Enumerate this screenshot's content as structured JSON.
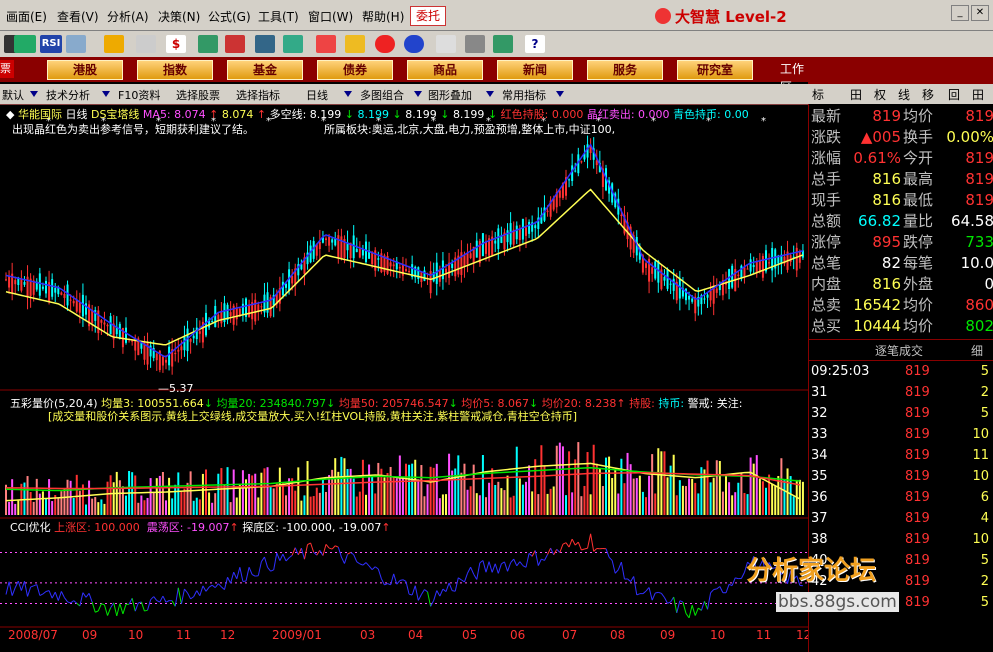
{
  "menu": [
    "画面(E)",
    "查看(V)",
    "分析(A)",
    "决策(N)",
    "公式(G)",
    "工具(T)",
    "窗口(W)",
    "帮助(H)"
  ],
  "entrust_label": "委托",
  "brand": "大智慧 Level-2",
  "nav": {
    "left_label": "票",
    "buttons": [
      "港股",
      "指数",
      "基金",
      "债券",
      "商品",
      "新闻",
      "服务",
      "研究室"
    ],
    "workarea": "工作区"
  },
  "sidetabs": [
    "标",
    "田",
    "权",
    "线",
    "移",
    "回",
    "田"
  ],
  "subtool": [
    "默认",
    "技术分析",
    "F10资料",
    "选择股票",
    "选择指标",
    "日线",
    "多图组合",
    "图形叠加",
    "常用指标"
  ],
  "main_chart": {
    "stock_name": "华能国际",
    "period": "日线",
    "indicator_name": "DS宝塔线",
    "ma5": "MA5: 8.074",
    "ma5_b": "8.074",
    "duokong": "多空线: 8.199",
    "v1": "8.199",
    "v2": "8.199",
    "v3": "8.199",
    "red_hold": "红色持股: 0.000",
    "crystal": "晶红卖出: 0.000",
    "cyan_hold": "青色持币: 0.00",
    "hint": "出现晶红色为卖出参考信号，短期获利建议了结。",
    "sector": "所属板块:奥运,北京,大盘,电力,预盈预增,整体上市,中证100,",
    "low_label": "5.37"
  },
  "volume_chart": {
    "name": "五彩量价(5,20,4)",
    "jl3": "均量3: 100551.664",
    "jl20": "均量20: 234840.797",
    "jl50": "均量50: 205746.547",
    "jj5": "均价5: 8.067",
    "jj20": "均价20: 8.238",
    "hold": "持股:",
    "cash": "持币:",
    "warn": "警戒:",
    "watch": "关注:",
    "desc": "[成交量和股价关系图示,黄线上交绿线,成交量放大,买入!红柱VOL持股,黄柱关注,紫柱警戒减仓,青柱空仓持币]"
  },
  "cci_chart": {
    "name": "CCI优化",
    "up": "上涨区: 100.000",
    "shock": "震荡区: -19.007",
    "bottom": "探底区: -100.000, -19.007"
  },
  "time_axis": [
    "2008/07",
    "09",
    "10",
    "11",
    "12",
    "2009/01",
    "03",
    "04",
    "05",
    "06",
    "07",
    "08",
    "09",
    "10",
    "11",
    "12"
  ],
  "quote": {
    "rows": [
      {
        "l": "最新",
        "v1": "819",
        "c1": "red",
        "l2": "均价",
        "v2": "819",
        "c2": "red"
      },
      {
        "l": "涨跌",
        "v1": "▲005",
        "c1": "red",
        "l2": "换手",
        "v2": "0.00%",
        "c2": "yel"
      },
      {
        "l": "涨幅",
        "v1": "0.61%",
        "c1": "red",
        "l2": "今开",
        "v2": "819",
        "c2": "red"
      },
      {
        "l": "总手",
        "v1": "816",
        "c1": "yel",
        "l2": "最高",
        "v2": "819",
        "c2": "red"
      },
      {
        "l": "现手",
        "v1": "816",
        "c1": "yel",
        "l2": "最低",
        "v2": "819",
        "c2": "red"
      },
      {
        "l": "总额",
        "v1": "66.82",
        "c1": "cyn",
        "l2": "量比",
        "v2": "64.58",
        "c2": "wht"
      },
      {
        "l": "涨停",
        "v1": "895",
        "c1": "red",
        "l2": "跌停",
        "v2": "733",
        "c2": "grn"
      },
      {
        "l": "总笔",
        "v1": "82",
        "c1": "wht",
        "l2": "每笔",
        "v2": "10.0",
        "c2": "wht"
      },
      {
        "l": "内盘",
        "v1": "816",
        "c1": "yel",
        "l2": "外盘",
        "v2": "0",
        "c2": "wht"
      },
      {
        "l": "总卖",
        "v1": "16542",
        "c1": "yel",
        "l2": "均价",
        "v2": "860",
        "c2": "red"
      },
      {
        "l": "总买",
        "v1": "10444",
        "c1": "yel",
        "l2": "均价",
        "v2": "802",
        "c2": "grn"
      }
    ],
    "tick_header": "逐笔成交",
    "tick_header_right": "细",
    "ticks": [
      {
        "a": "09:25:03",
        "b": "819",
        "c": "5"
      },
      {
        "a": "31",
        "b": "819",
        "c": "2"
      },
      {
        "a": "32",
        "b": "819",
        "c": "5"
      },
      {
        "a": "33",
        "b": "819",
        "c": "10"
      },
      {
        "a": "34",
        "b": "819",
        "c": "11"
      },
      {
        "a": "35",
        "b": "819",
        "c": "10"
      },
      {
        "a": "36",
        "b": "819",
        "c": "6"
      },
      {
        "a": "37",
        "b": "819",
        "c": "4"
      },
      {
        "a": "38",
        "b": "819",
        "c": "10"
      },
      {
        "a": "40",
        "b": "819",
        "c": "5"
      },
      {
        "a": "42",
        "b": "819",
        "c": "2"
      },
      {
        "a": "43",
        "b": "819",
        "c": "5"
      }
    ]
  },
  "watermark": {
    "title": "分析家论坛",
    "url": "bbs.88gs.com"
  },
  "chart_data": [
    {
      "type": "candlestick",
      "title": "华能国际 日线 DS宝塔线",
      "ma5": 8.074,
      "duokong": 8.199,
      "low_mark": 5.37,
      "x": [
        "2008/07",
        "09",
        "10",
        "11",
        "12",
        "2009/01",
        "03",
        "04",
        "05",
        "06",
        "07",
        "08",
        "09",
        "10",
        "11",
        "12"
      ],
      "series": [
        {
          "name": "price",
          "values": [
            7.6,
            7.3,
            6.4,
            5.6,
            6.7,
            7.0,
            8.6,
            8.1,
            7.6,
            8.4,
            8.9,
            10.8,
            8.0,
            7.0,
            7.9,
            8.2
          ]
        },
        {
          "name": "多空线",
          "values": [
            7.3,
            7.0,
            6.2,
            6.0,
            6.6,
            6.9,
            8.2,
            7.9,
            7.6,
            8.1,
            8.6,
            9.8,
            8.3,
            7.3,
            7.7,
            8.2
          ]
        }
      ]
    },
    {
      "type": "bar",
      "title": "五彩量价(5,20,4)",
      "x": [
        "2008/07",
        "09",
        "10",
        "11",
        "12",
        "2009/01",
        "03",
        "04",
        "05",
        "06",
        "07",
        "08",
        "09",
        "10",
        "11",
        "12"
      ],
      "series": [
        {
          "name": "均量3",
          "values": [
            100000,
            120000,
            150000,
            160000,
            180000,
            200000,
            260000,
            280000,
            230000,
            300000,
            340000,
            360000,
            290000,
            260000,
            300000,
            100552
          ]
        },
        {
          "name": "均量20",
          "values": [
            180000,
            170000,
            190000,
            200000,
            210000,
            220000,
            250000,
            270000,
            260000,
            290000,
            310000,
            330000,
            300000,
            280000,
            270000,
            234841
          ]
        },
        {
          "name": "均量50",
          "values": [
            190000,
            185000,
            185000,
            190000,
            195000,
            200000,
            215000,
            230000,
            240000,
            255000,
            270000,
            290000,
            295000,
            285000,
            275000,
            205747
          ]
        }
      ]
    },
    {
      "type": "line",
      "title": "CCI优化",
      "x": [
        "2008/07",
        "09",
        "10",
        "11",
        "12",
        "2009/01",
        "03",
        "04",
        "05",
        "06",
        "07",
        "08",
        "09",
        "10",
        "11",
        "12"
      ],
      "series": [
        {
          "name": "CCI",
          "values": [
            -40,
            -60,
            -120,
            -90,
            -20,
            60,
            120,
            20,
            -80,
            40,
            80,
            150,
            -60,
            -140,
            60,
            -19.007
          ]
        }
      ],
      "reference_lines": [
        100,
        -19.007,
        -100
      ]
    }
  ]
}
